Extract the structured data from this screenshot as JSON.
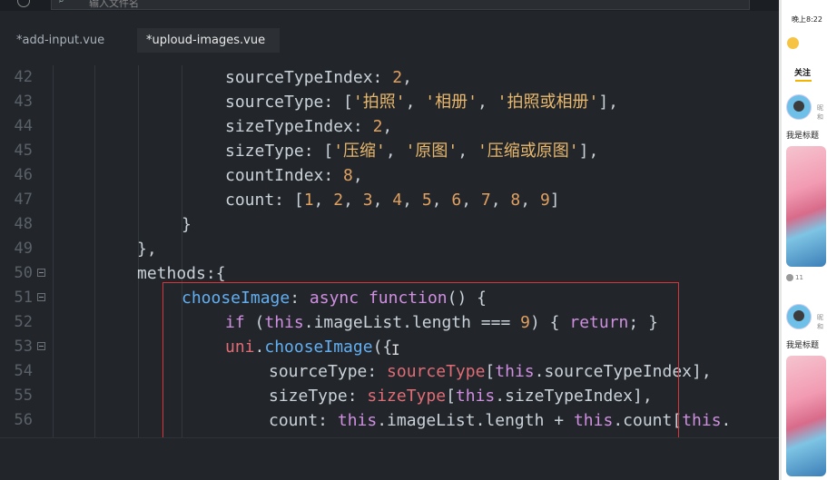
{
  "topbar": {
    "search_placeholder": "输入文件名"
  },
  "tabs": [
    {
      "label": "*add-input.vue",
      "active": false
    },
    {
      "label": "*uploud-images.vue",
      "active": true
    }
  ],
  "code_lines": [
    {
      "num": "42",
      "fold": false,
      "indent": 248,
      "tokens": [
        [
          "p",
          "sourceTypeIndex: "
        ],
        [
          "n",
          "2"
        ],
        [
          "p",
          ","
        ]
      ]
    },
    {
      "num": "43",
      "fold": false,
      "indent": 248,
      "tokens": [
        [
          "p",
          "sourceType: ["
        ],
        [
          "s",
          "'拍照'"
        ],
        [
          "p",
          ", "
        ],
        [
          "s",
          "'相册'"
        ],
        [
          "p",
          ", "
        ],
        [
          "s",
          "'拍照或相册'"
        ],
        [
          "p",
          "],"
        ]
      ]
    },
    {
      "num": "44",
      "fold": false,
      "indent": 248,
      "tokens": [
        [
          "p",
          "sizeTypeIndex: "
        ],
        [
          "n",
          "2"
        ],
        [
          "p",
          ","
        ]
      ]
    },
    {
      "num": "45",
      "fold": false,
      "indent": 248,
      "tokens": [
        [
          "p",
          "sizeType: ["
        ],
        [
          "s",
          "'压缩'"
        ],
        [
          "p",
          ", "
        ],
        [
          "s",
          "'原图'"
        ],
        [
          "p",
          ", "
        ],
        [
          "s",
          "'压缩或原图'"
        ],
        [
          "p",
          "],"
        ]
      ]
    },
    {
      "num": "46",
      "fold": false,
      "indent": 248,
      "tokens": [
        [
          "p",
          "countIndex: "
        ],
        [
          "n",
          "8"
        ],
        [
          "p",
          ","
        ]
      ]
    },
    {
      "num": "47",
      "fold": false,
      "indent": 248,
      "tokens": [
        [
          "p",
          "count: ["
        ],
        [
          "n",
          "1"
        ],
        [
          "p",
          ", "
        ],
        [
          "n",
          "2"
        ],
        [
          "p",
          ", "
        ],
        [
          "n",
          "3"
        ],
        [
          "p",
          ", "
        ],
        [
          "n",
          "4"
        ],
        [
          "p",
          ", "
        ],
        [
          "n",
          "5"
        ],
        [
          "p",
          ", "
        ],
        [
          "n",
          "6"
        ],
        [
          "p",
          ", "
        ],
        [
          "n",
          "7"
        ],
        [
          "p",
          ", "
        ],
        [
          "n",
          "8"
        ],
        [
          "p",
          ", "
        ],
        [
          "n",
          "9"
        ],
        [
          "p",
          "]"
        ]
      ]
    },
    {
      "num": "48",
      "fold": false,
      "indent": 200,
      "tokens": [
        [
          "p",
          "}"
        ]
      ]
    },
    {
      "num": "49",
      "fold": false,
      "indent": 151,
      "tokens": [
        [
          "p",
          "},"
        ]
      ]
    },
    {
      "num": "50",
      "fold": true,
      "indent": 151,
      "tokens": [
        [
          "p",
          "methods:{"
        ]
      ]
    },
    {
      "num": "51",
      "fold": true,
      "indent": 200,
      "tokens": [
        [
          "f",
          "chooseImage"
        ],
        [
          "p",
          ": "
        ],
        [
          "k",
          "async"
        ],
        [
          "p",
          " "
        ],
        [
          "k",
          "function"
        ],
        [
          "p",
          "() {"
        ]
      ]
    },
    {
      "num": "52",
      "fold": false,
      "indent": 248,
      "tokens": [
        [
          "k",
          "if"
        ],
        [
          "p",
          " ("
        ],
        [
          "k",
          "this"
        ],
        [
          "p",
          ".imageList.length === "
        ],
        [
          "n",
          "9"
        ],
        [
          "p",
          ") { "
        ],
        [
          "k",
          "return"
        ],
        [
          "p",
          "; }"
        ]
      ]
    },
    {
      "num": "53",
      "fold": true,
      "indent": 248,
      "tokens": [
        [
          "r",
          "uni"
        ],
        [
          "p",
          "."
        ],
        [
          "f",
          "chooseImage"
        ],
        [
          "p",
          "({"
        ]
      ]
    },
    {
      "num": "54",
      "fold": false,
      "indent": 296,
      "tokens": [
        [
          "p",
          "sourceType: "
        ],
        [
          "r",
          "sourceType"
        ],
        [
          "p",
          "["
        ],
        [
          "k",
          "this"
        ],
        [
          "p",
          ".sourceTypeIndex],"
        ]
      ]
    },
    {
      "num": "55",
      "fold": false,
      "indent": 296,
      "tokens": [
        [
          "p",
          "sizeType: "
        ],
        [
          "r",
          "sizeType"
        ],
        [
          "p",
          "["
        ],
        [
          "k",
          "this"
        ],
        [
          "p",
          ".sizeTypeIndex],"
        ]
      ]
    },
    {
      "num": "56",
      "fold": false,
      "indent": 296,
      "tokens": [
        [
          "p",
          "count: "
        ],
        [
          "k",
          "this"
        ],
        [
          "p",
          ".imageList.length + "
        ],
        [
          "k",
          "this"
        ],
        [
          "p",
          ".count["
        ],
        [
          "k",
          "this"
        ],
        [
          "p",
          "."
        ]
      ]
    }
  ],
  "phone": {
    "time": "晚上8:22",
    "tab_follow": "关注",
    "posts": [
      {
        "nick": "昵和",
        "title": "我是标题",
        "likes": "11"
      },
      {
        "nick": "昵和",
        "title": "我是标题"
      }
    ]
  },
  "colors": {
    "highlight_box": "#d8343a",
    "editor_bg": "#22262b"
  }
}
